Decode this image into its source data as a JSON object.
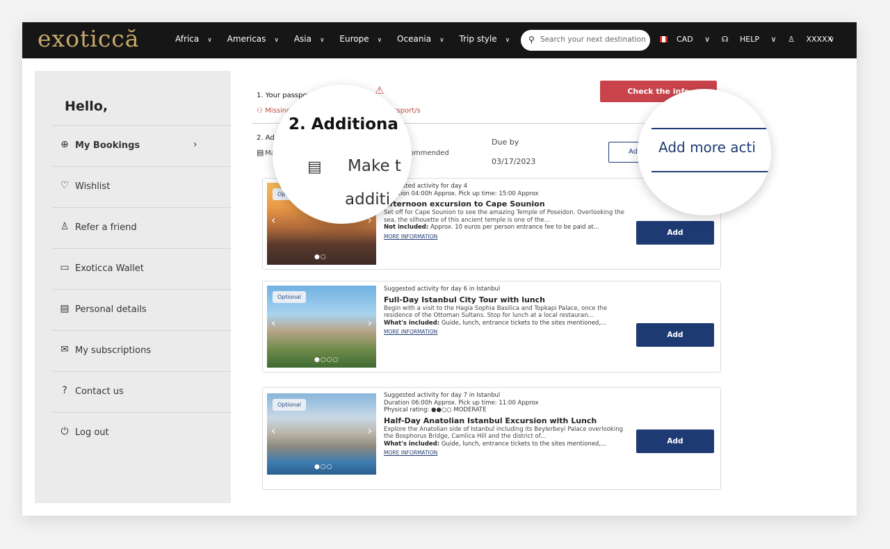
{
  "nav": {
    "logo": "exoticcă",
    "menu": [
      {
        "label": "Africa"
      },
      {
        "label": "Americas"
      },
      {
        "label": "Asia"
      },
      {
        "label": "Europe"
      },
      {
        "label": "Oceania"
      },
      {
        "label": "Trip style"
      }
    ],
    "search_placeholder": "Search your next destination",
    "currency": "CAD",
    "help": "HELP",
    "user": "XXXXX"
  },
  "sidebar": {
    "greeting": "Hello,",
    "items": [
      {
        "label": "My Bookings",
        "icon": "globe-icon",
        "active": true
      },
      {
        "label": "Wishlist",
        "icon": "heart-icon"
      },
      {
        "label": "Refer a friend",
        "icon": "add-person-icon"
      },
      {
        "label": "Exoticca Wallet",
        "icon": "wallet-icon"
      },
      {
        "label": "Personal details",
        "icon": "id-card-icon"
      },
      {
        "label": "My subscriptions",
        "icon": "mail-icon"
      },
      {
        "label": "Contact us",
        "icon": "help-circle-icon"
      },
      {
        "label": "Log out",
        "icon": "power-icon"
      }
    ]
  },
  "section1": {
    "title": "1. Your passport information",
    "subtitle": "Missing passport info. Check your passport/s",
    "button": "Check the info"
  },
  "section2": {
    "title": "2. Additional activities",
    "subtitle": "Make the most of your trip — booking recommended",
    "due_label": "Due by",
    "due_date": "03/17/2023",
    "button": "Add more activities"
  },
  "activities": [
    {
      "badge": "Optional",
      "meta1": "Suggested activity for day 4",
      "meta2": "Duration 04:00h Approx. Pick up time: 15:00 Approx",
      "title": "Afternoon excursion to Cape Sounion",
      "desc": "Set off for Cape Sounion to see the amazing Temple of Poseidon. Overlooking the sea, the silhouette of this ancient temple is one of the...",
      "incl_label": "Not included:",
      "incl_text": "Approx. 10 euros per person entrance fee to be paid at...",
      "more": "MORE INFORMATION",
      "add": "Add",
      "dots": "●○"
    },
    {
      "badge": "Optional",
      "meta1": "Suggested activity for day 6 in Istanbul",
      "title": "Full-Day Istanbul City Tour with lunch",
      "desc": "Begin with a visit to the Hagia Sophia Basilica and Topkapi Palace, once the residence of the Ottoman Sultans. Stop for lunch at a local restauran...",
      "incl_label": "What's included:",
      "incl_text": "Guide, lunch, entrance tickets to the sites mentioned,...",
      "more": "MORE INFORMATION",
      "add": "Add",
      "dots": "●○○○"
    },
    {
      "badge": "Optional",
      "meta1": "Suggested activity for day 7 in Istanbul",
      "meta2": "Duration 06:00h Approx. Pick up time: 11:00 Approx",
      "meta3": "Physical rating: ●●○○ MODERATE",
      "title": "Half-Day Anatolian Istanbul Excursion with Lunch",
      "desc": "Explore the Anatolian side of Istanbul including its Beylerbeyi Palace overlooking the Bosphorus Bridge, Camlica Hill and the district of...",
      "incl_label": "What's included:",
      "incl_text": "Guide, lunch, entrance tickets to the sites mentioned,...",
      "more": "MORE INFORMATION",
      "add": "Add",
      "dots": "●○○"
    }
  ],
  "zoom": {
    "lens1_title": "2. Additiona",
    "lens1_line1": "Make t",
    "lens1_line2": "additi",
    "lens2_label": "Add more acti"
  }
}
